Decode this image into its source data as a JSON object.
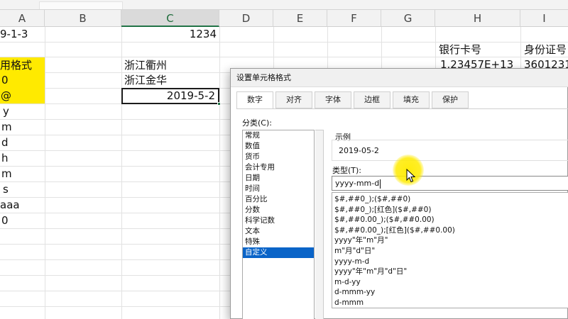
{
  "columns": [
    {
      "id": "A",
      "label": "A"
    },
    {
      "id": "B",
      "label": "B"
    },
    {
      "id": "C",
      "label": "C"
    },
    {
      "id": "D",
      "label": "D"
    },
    {
      "id": "E",
      "label": "E"
    },
    {
      "id": "F",
      "label": "F"
    },
    {
      "id": "G",
      "label": "G"
    },
    {
      "id": "H",
      "label": "H"
    },
    {
      "id": "I",
      "label": "I"
    }
  ],
  "cells": {
    "a1": "9-1-3",
    "c1": "1234",
    "h3": "银行卡号",
    "i3": "身份证号",
    "h4": "1.23457E+13",
    "i4": "3601231",
    "a4": "用格式",
    "c4": "浙江衢州",
    "a5": "0",
    "c5": "浙江金华",
    "a6": "@",
    "c6": "2019-5-2",
    "a7": "y",
    "a8": "m",
    "a9": "d",
    "a10": "h",
    "a11": "m",
    "a12": "s",
    "a13": "aaa",
    "a14": "0"
  },
  "colors": {
    "highlight": "#ffea00",
    "selection_blue": "#0a64c8",
    "excel_green": "#217346"
  },
  "dialog": {
    "title": "设置单元格格式",
    "tabs": [
      "数字",
      "对齐",
      "字体",
      "边框",
      "填充",
      "保护"
    ],
    "active_tab": "数字",
    "category_label": "分类(C):",
    "categories": [
      "常规",
      "数值",
      "货币",
      "会计专用",
      "日期",
      "时间",
      "百分比",
      "分数",
      "科学记数",
      "文本",
      "特殊",
      "自定义"
    ],
    "selected_category": "自定义",
    "sample_label": "示例",
    "sample_value": "2019-05-2",
    "type_label": "类型(T):",
    "type_value": "yyyy-mm-d",
    "formats": [
      "$#,##0_);($#,##0)",
      "$#,##0_);[红色]($#,##0)",
      "$#,##0.00_);($#,##0.00)",
      "$#,##0.00_);[红色]($#,##0.00)",
      "yyyy\"年\"m\"月\"",
      "m\"月\"d\"日\"",
      "yyyy-m-d",
      "yyyy\"年\"m\"月\"d\"日\"",
      "m-d-yy",
      "d-mmm-yy",
      "d-mmm"
    ]
  }
}
